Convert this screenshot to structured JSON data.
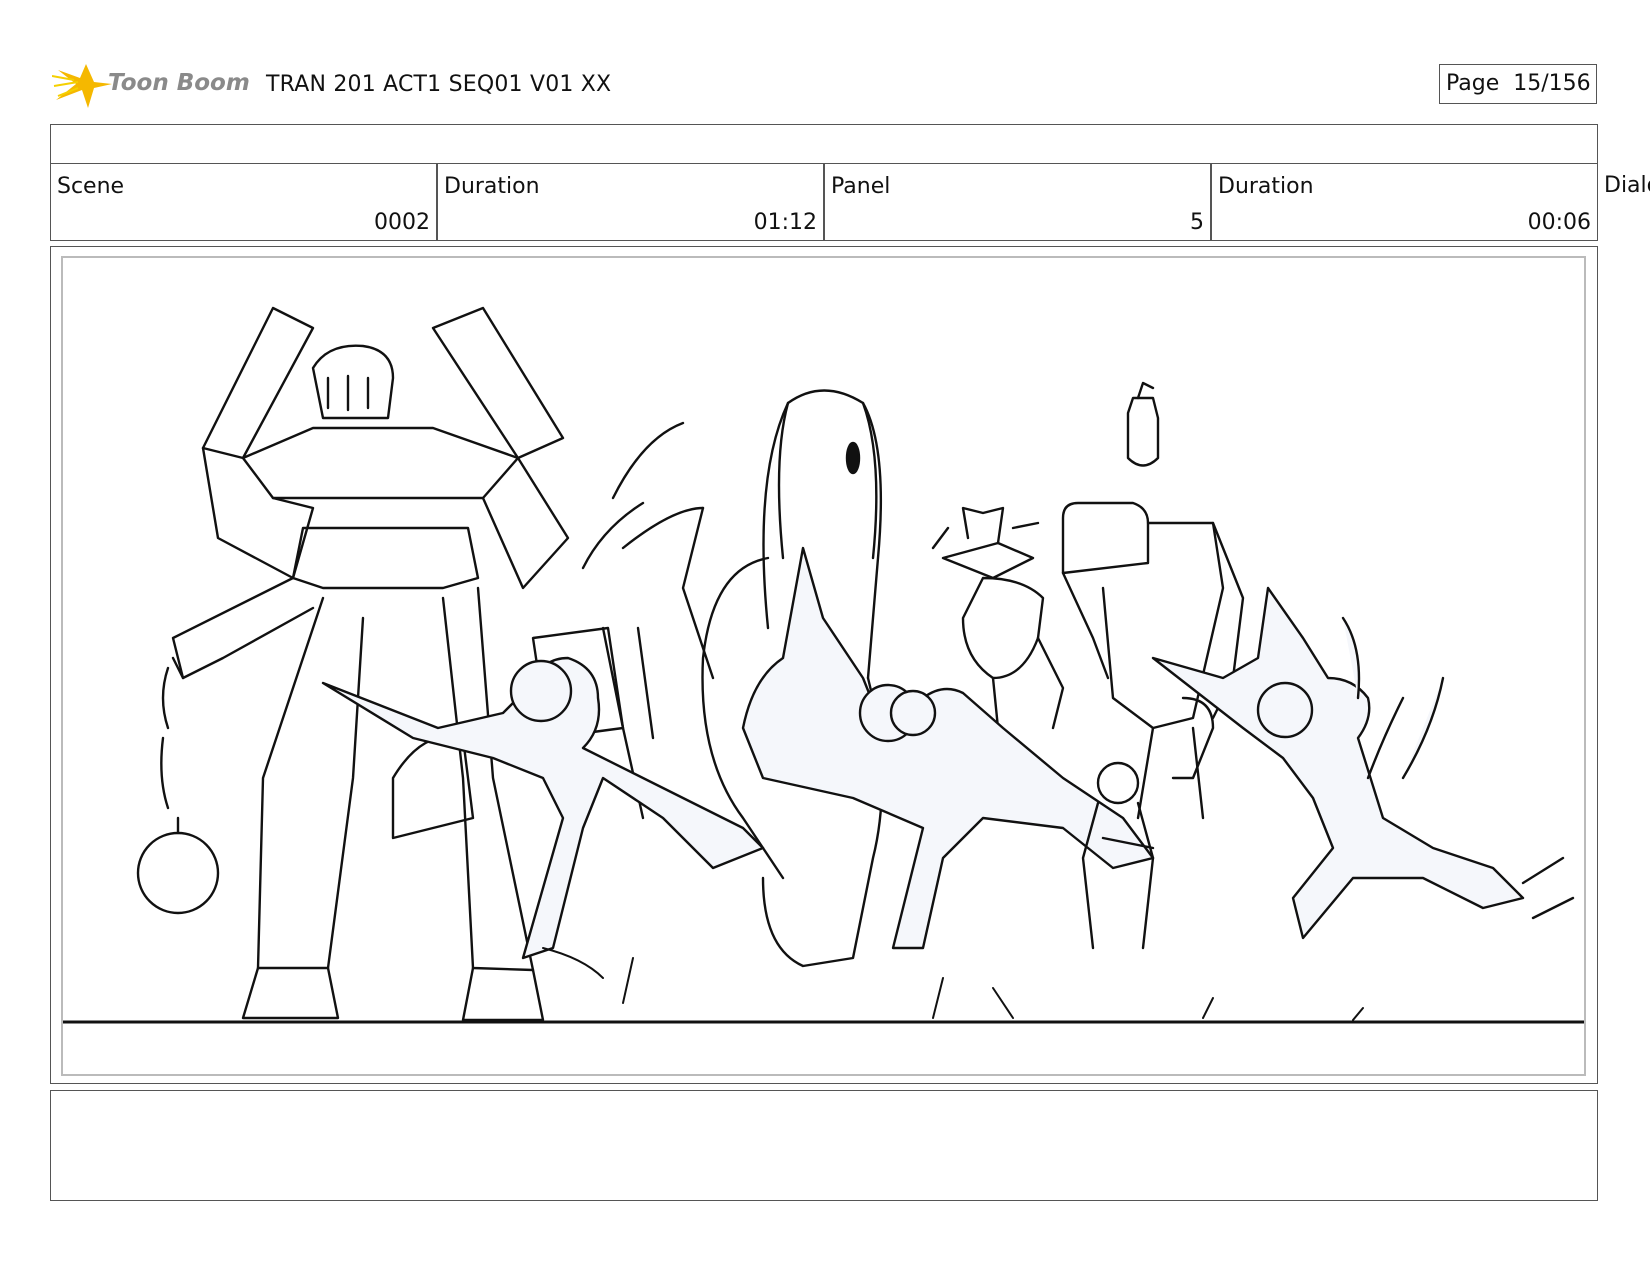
{
  "header": {
    "brand": "Toon Boom",
    "title": "TRAN 201 ACT1 SEQ01 V01 XX",
    "page_label": "Page",
    "page_value": "15/156"
  },
  "info": {
    "scene_label": "Scene",
    "scene_value": "0002",
    "duration_label": "Duration",
    "duration_value": "01:12",
    "panel_label": "Panel",
    "panel_value": "5",
    "panel_duration_label": "Duration",
    "panel_duration_value": "00:06",
    "dialog_label": "Dialo"
  },
  "colors": {
    "logo_star": "#f5b800",
    "logo_text": "#8a8a8a",
    "ink": "#111111",
    "fill": "#f5f7fb"
  }
}
